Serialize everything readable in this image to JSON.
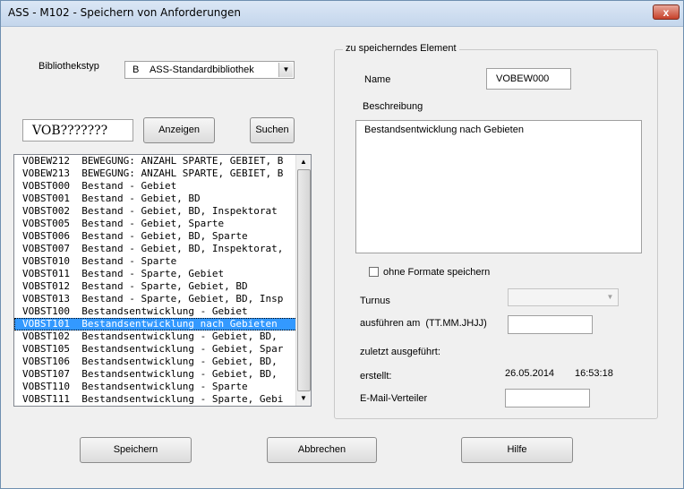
{
  "window": {
    "title": "ASS - M102 - Speichern von Anforderungen",
    "close_glyph": "x"
  },
  "library": {
    "label": "Bibliothekstyp",
    "selected": "B    ASS-Standardbibliothek"
  },
  "filter": {
    "value": "VOB???????",
    "show_button": "Anzeigen",
    "search_button": "Suchen"
  },
  "list": {
    "items": [
      "VOBEW212  BEWEGUNG: ANZAHL SPARTE, GEBIET, B",
      "VOBEW213  BEWEGUNG: ANZAHL SPARTE, GEBIET, B",
      "VOBST000  Bestand - Gebiet",
      "VOBST001  Bestand - Gebiet, BD",
      "VOBST002  Bestand - Gebiet, BD, Inspektorat",
      "VOBST005  Bestand - Gebiet, Sparte",
      "VOBST006  Bestand - Gebiet, BD, Sparte",
      "VOBST007  Bestand - Gebiet, BD, Inspektorat,",
      "VOBST010  Bestand - Sparte",
      "VOBST011  Bestand - Sparte, Gebiet",
      "VOBST012  Bestand - Sparte, Gebiet, BD",
      "VOBST013  Bestand - Sparte, Gebiet, BD, Insp",
      "VOBST100  Bestandsentwicklung - Gebiet",
      "VOBST101  Bestandsentwicklung nach Gebieten",
      "VOBST102  Bestandsentwicklung - Gebiet, BD,",
      "VOBST105  Bestandsentwicklung - Gebiet, Spar",
      "VOBST106  Bestandsentwicklung - Gebiet, BD,",
      "VOBST107  Bestandsentwicklung - Gebiet, BD,",
      "VOBST110  Bestandsentwicklung - Sparte",
      "VOBST111  Bestandsentwicklung - Sparte, Gebi"
    ],
    "selected_index": 13
  },
  "element": {
    "group_title": "zu speicherndes Element",
    "name_label": "Name",
    "name_value": "VOBEW000",
    "description_label": "Beschreibung",
    "description_value": "Bestandsentwicklung nach Gebieten",
    "no_formats_label": "ohne Formate speichern",
    "no_formats_checked": false,
    "interval_label": "Turnus",
    "interval_value": "",
    "run_at_label": "ausführen am  (TT.MM.JHJJ)",
    "run_at_value": "",
    "last_run_label": "zuletzt ausgeführt:",
    "created_label": "erstellt:",
    "created_date": "26.05.2014",
    "created_time": "16:53:18",
    "email_label": "E-Mail-Verteiler",
    "email_value": ""
  },
  "buttons": {
    "save": "Speichern",
    "cancel": "Abbrechen",
    "help": "Hilfe"
  }
}
